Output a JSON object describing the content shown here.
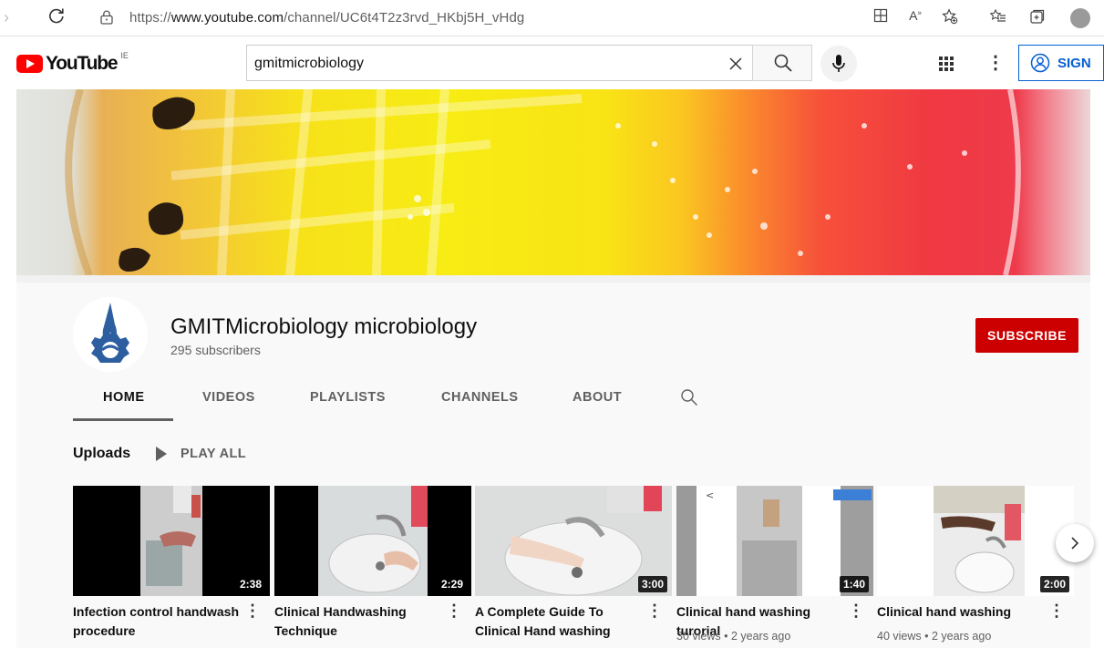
{
  "browser": {
    "url_prefix": "https://",
    "url_host": "www.youtube.com",
    "url_path": "/channel/UC6t4T2z3rvd_HKbj5H_vHdg"
  },
  "header": {
    "logo_text": "YouTube",
    "country_code": "IE",
    "search_value": "gmitmicrobiology",
    "signin_label": "SIGN"
  },
  "channel": {
    "name": "GMITMicrobiology microbiology",
    "subscribers": "295 subscribers",
    "subscribe_label": "SUBSCRIBE",
    "tabs": [
      "HOME",
      "VIDEOS",
      "PLAYLISTS",
      "CHANNELS",
      "ABOUT"
    ],
    "active_tab": "HOME"
  },
  "uploads": {
    "heading": "Uploads",
    "play_all": "PLAY ALL",
    "videos": [
      {
        "title": "Infection control handwash procedure",
        "duration": "2:38",
        "meta": ""
      },
      {
        "title": "Clinical Handwashing Technique",
        "duration": "2:29",
        "meta": ""
      },
      {
        "title": "A Complete Guide To Clinical Hand washing",
        "duration": "3:00",
        "meta": ""
      },
      {
        "title": "Clinical hand washing turorial",
        "duration": "1:40",
        "meta": "30 views • 2 years ago"
      },
      {
        "title": "Clinical hand washing",
        "duration": "2:00",
        "meta": "40 views • 2 years ago"
      }
    ]
  },
  "colors": {
    "youtube_red": "#ff0000",
    "subscribe_red": "#cc0000",
    "link_blue": "#065fd4",
    "channel_bg": "#f9f9f9"
  },
  "icons": [
    "back-icon",
    "reload-icon",
    "lock-icon",
    "search-icon",
    "clear-icon",
    "mic-icon",
    "apps-icon",
    "more-icon",
    "account-icon",
    "play-icon",
    "chevron-right-icon"
  ]
}
